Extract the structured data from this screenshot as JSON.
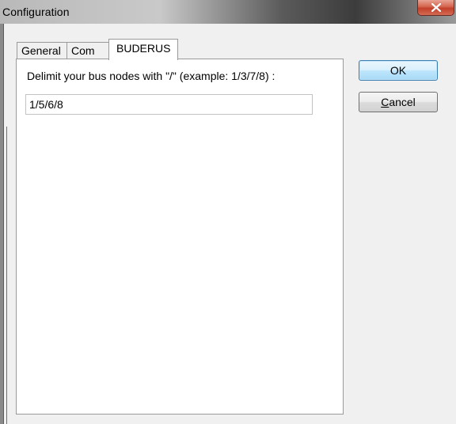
{
  "window": {
    "title": "Configuration"
  },
  "tabs": [
    {
      "label": "General",
      "active": false
    },
    {
      "label": "Com",
      "active": false
    },
    {
      "label": "BUDERUS",
      "active": true
    }
  ],
  "buderus": {
    "instruction": "Delimit your bus nodes with \"/\" (example: 1/3/7/8) :",
    "bus_nodes_value": "1/5/6/8"
  },
  "buttons": {
    "ok_label": "OK",
    "cancel_label": "Cancel",
    "cancel_accelerator": "C",
    "cancel_rest": "ancel"
  },
  "icons": {
    "close": "close-icon"
  },
  "colors": {
    "dialog_bg": "#f0f0f0",
    "close_button": "#c2402a",
    "default_button_border": "#3c7fb1"
  }
}
